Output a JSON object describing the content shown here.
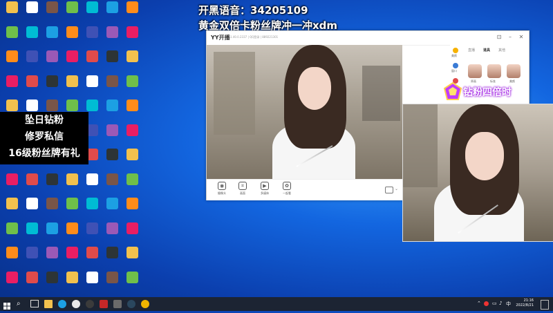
{
  "overlay": {
    "line1_prefix": "开黑语音：",
    "line1_number": "34205109",
    "line2": "黄金双倍卡粉丝牌冲一冲xdm",
    "caption": [
      "坠日钻粉",
      "修罗私信",
      "16级粉丝牌有礼"
    ],
    "badge_text": "钻粉四倍时"
  },
  "yy_window": {
    "app_name": "YY开播",
    "version": "1.40.0.2337 | QQ登录 | 889221301",
    "bottom_bar": [
      {
        "label": "摄像头",
        "icon": "camera-icon"
      },
      {
        "label": "画面",
        "icon": "crop-icon"
      },
      {
        "label": "多媒体",
        "icon": "media-icon"
      },
      {
        "label": "一起看",
        "icon": "watch-icon"
      }
    ],
    "side_tabs": [
      "直播",
      "道具",
      "其他"
    ],
    "side_items": [
      "美颜",
      "窗口",
      "布局"
    ],
    "avatar_labels": [
      "原画",
      "标准",
      "美颜"
    ]
  },
  "taskbar": {
    "time": "21:16",
    "date": "2022/8/21"
  },
  "colors": {
    "taskbar_bg": "#1c2433",
    "desktop_blue": "#1366e0",
    "badge_purple": "#b000ff"
  },
  "desktop_icon_count": 84
}
